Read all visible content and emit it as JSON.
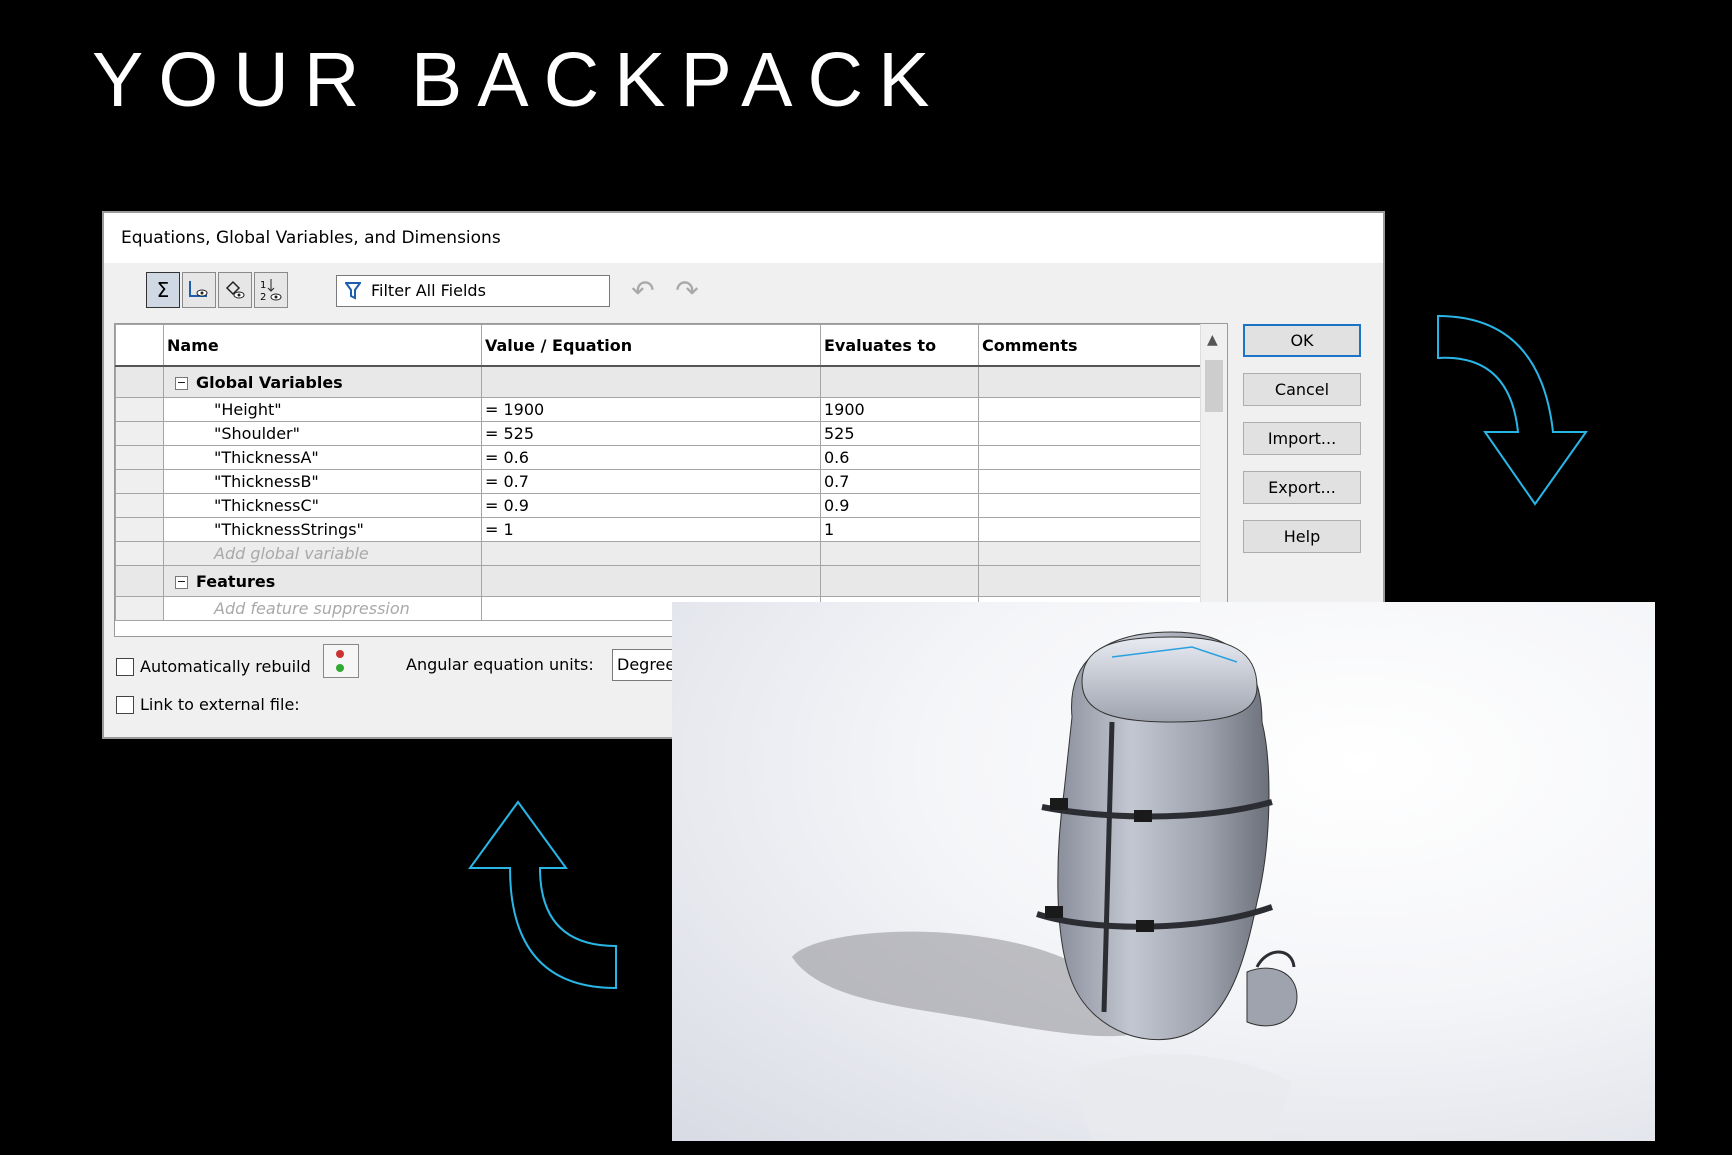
{
  "slide": {
    "title": "YOUR BACKPACK"
  },
  "dialog": {
    "title": "Equations, Global Variables, and Dimensions",
    "filter_placeholder": "Filter All Fields",
    "toolbar": [
      {
        "name": "equation-view-icon",
        "active": true
      },
      {
        "name": "sketch-equation-view-icon",
        "active": false
      },
      {
        "name": "dimension-view-icon",
        "active": false
      },
      {
        "name": "ordered-view-icon",
        "active": false
      }
    ],
    "columns": [
      "Name",
      "Value / Equation",
      "Evaluates to",
      "Comments"
    ],
    "groups": {
      "global": "Global Variables",
      "features": "Features"
    },
    "rows": [
      {
        "name": "\"Height\"",
        "value": "= 1900",
        "evaluates": "1900",
        "comment": ""
      },
      {
        "name": "\"Shoulder\"",
        "value": "= 525",
        "evaluates": "525",
        "comment": ""
      },
      {
        "name": "\"ThicknessA\"",
        "value": "= 0.6",
        "evaluates": "0.6",
        "comment": ""
      },
      {
        "name": "\"ThicknessB\"",
        "value": "= 0.7",
        "evaluates": "0.7",
        "comment": ""
      },
      {
        "name": "\"ThicknessC\"",
        "value": "= 0.9",
        "evaluates": "0.9",
        "comment": ""
      },
      {
        "name": "\"ThicknessStrings\"",
        "value": "= 1",
        "evaluates": "1",
        "comment": ""
      }
    ],
    "add_global": "Add global variable",
    "add_feature": "Add feature suppression",
    "buttons": {
      "ok": "OK",
      "cancel": "Cancel",
      "import": "Import...",
      "export": "Export...",
      "help": "Help"
    },
    "auto_rebuild": "Automatically rebuild",
    "link_external": "Link to external file:",
    "angular_units_label": "Angular equation units:",
    "angular_units_value": "Degree"
  },
  "colors": {
    "arrow": "#29b6e6",
    "background": "#000000",
    "ok_border": "#1c74c7"
  }
}
